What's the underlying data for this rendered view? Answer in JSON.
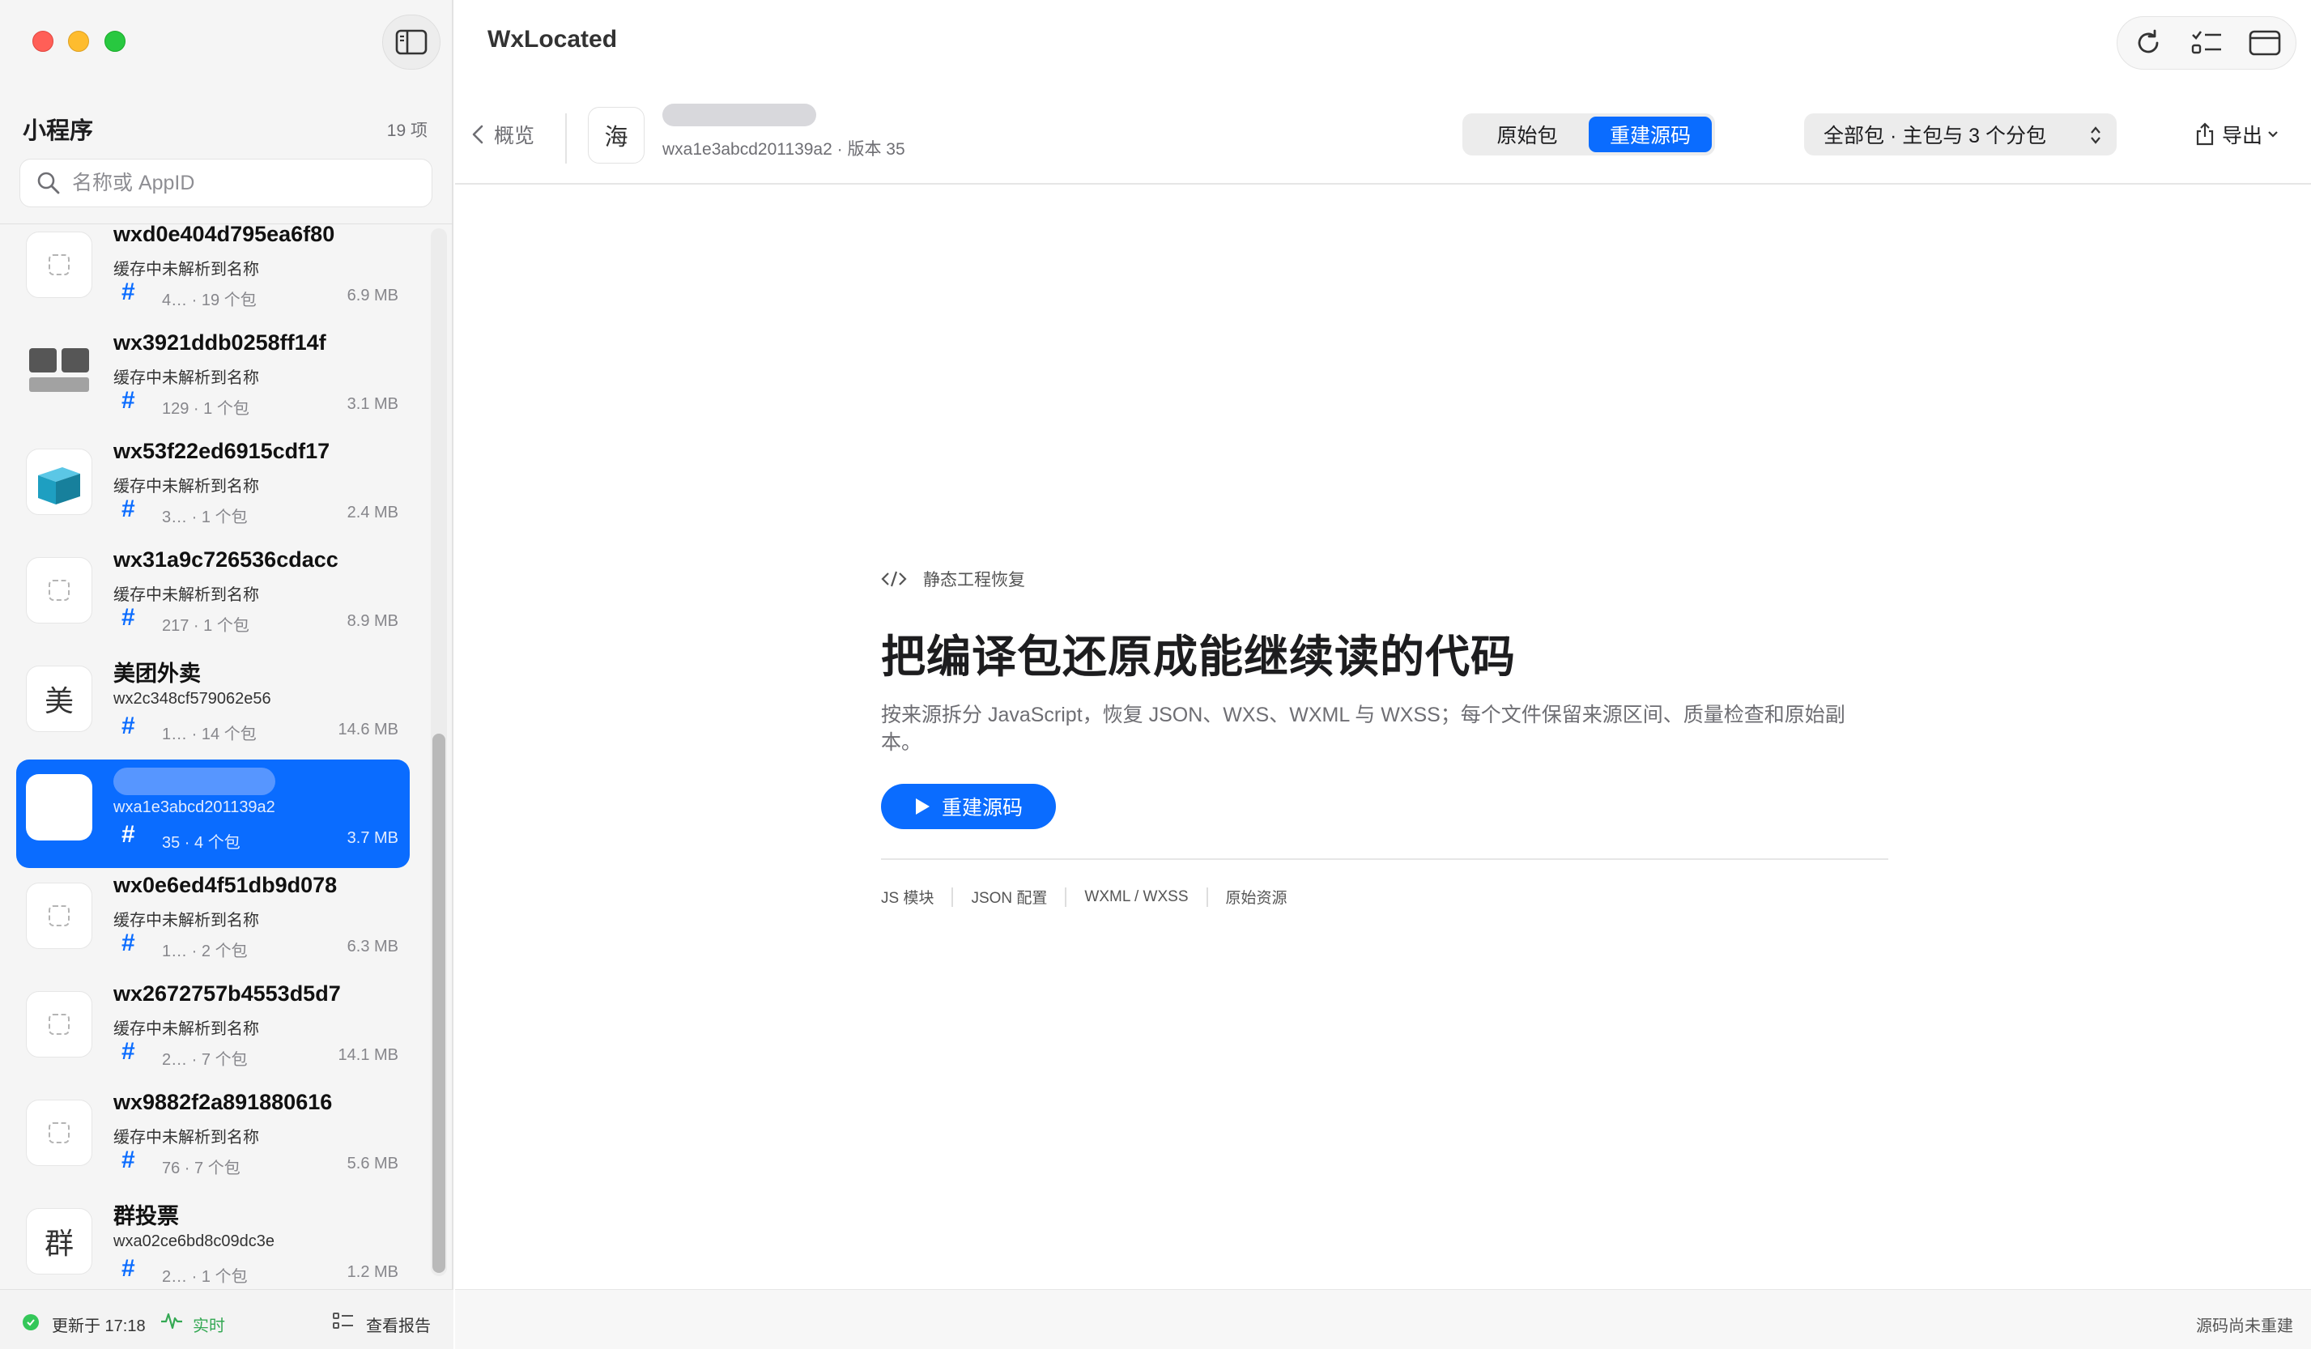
{
  "window": {
    "app_title": "WxLocated"
  },
  "sidebar": {
    "title": "小程序",
    "count": "19 项",
    "search_placeholder": "名称或 AppID",
    "items": [
      {
        "title": "wxd0e404d795ea6f80",
        "subtitle": "缓存中未解析到名称",
        "meta": "4… · 19 个包",
        "size": "6.9 MB",
        "icon": "placeholder-icon"
      },
      {
        "title": "wx3921ddb0258ff14f",
        "subtitle": "缓存中未解析到名称",
        "meta": "129 · 1 个包",
        "size": "3.1 MB",
        "icon": "brand-logo-icon"
      },
      {
        "title": "wx53f22ed6915cdf17",
        "subtitle": "缓存中未解析到名称",
        "meta": "3… · 1 个包",
        "size": "2.4 MB",
        "icon": "box-logo-icon"
      },
      {
        "title": "wx31a9c726536cdacc",
        "subtitle": "缓存中未解析到名称",
        "meta": "217 · 1 个包",
        "size": "8.9 MB",
        "icon": "placeholder-icon"
      },
      {
        "title": "美团外卖",
        "subtitle": "wx2c348cf579062e56",
        "meta": "1… · 14 个包",
        "size": "14.6 MB",
        "icon_char": "美"
      },
      {
        "title": "",
        "subtitle": "wxa1e3abcd201139a2",
        "meta": "35 · 4 个包",
        "size": "3.7 MB",
        "selected": true
      },
      {
        "title": "wx0e6ed4f51db9d078",
        "subtitle": "缓存中未解析到名称",
        "meta": "1… · 2 个包",
        "size": "6.3 MB",
        "icon": "placeholder-icon"
      },
      {
        "title": "wx2672757b4553d5d7",
        "subtitle": "缓存中未解析到名称",
        "meta": "2… · 7 个包",
        "size": "14.1 MB",
        "icon": "placeholder-icon"
      },
      {
        "title": "wx9882f2a891880616",
        "subtitle": "缓存中未解析到名称",
        "meta": "76 · 7 个包",
        "size": "5.6 MB",
        "icon": "placeholder-icon"
      },
      {
        "title": "群投票",
        "subtitle": "wxa02ce6bd8c09dc3e",
        "meta": "2… · 1 个包",
        "size": "1.2 MB",
        "icon_char": "群"
      }
    ],
    "footer": {
      "updated": "更新于 17:18",
      "live": "实时",
      "report": "查看报告"
    }
  },
  "header": {
    "back_label": "概览",
    "app_icon_char": "海",
    "app_id_line": "wxa1e3abcd201139a2 · 版本 35",
    "segments": [
      "原始包",
      "重建源码"
    ],
    "active_segment": "重建源码",
    "package_select": "全部包 · 主包与 3 个分包",
    "export_label": "导出"
  },
  "content": {
    "eyebrow": "静态工程恢复",
    "headline": "把编译包还原成能继续读的代码",
    "description": "按来源拆分 JavaScript，恢复 JSON、WXS、WXML 与 WXSS；每个文件保留来源区间、质量检查和原始副本。",
    "cta": "重建源码",
    "tags": [
      "JS 模块",
      "JSON 配置",
      "WXML / WXSS",
      "原始资源"
    ]
  },
  "status": {
    "right": "源码尚未重建"
  },
  "colors": {
    "accent": "#0a6cff",
    "live_green": "#34a853",
    "ok_green": "#34c759"
  }
}
